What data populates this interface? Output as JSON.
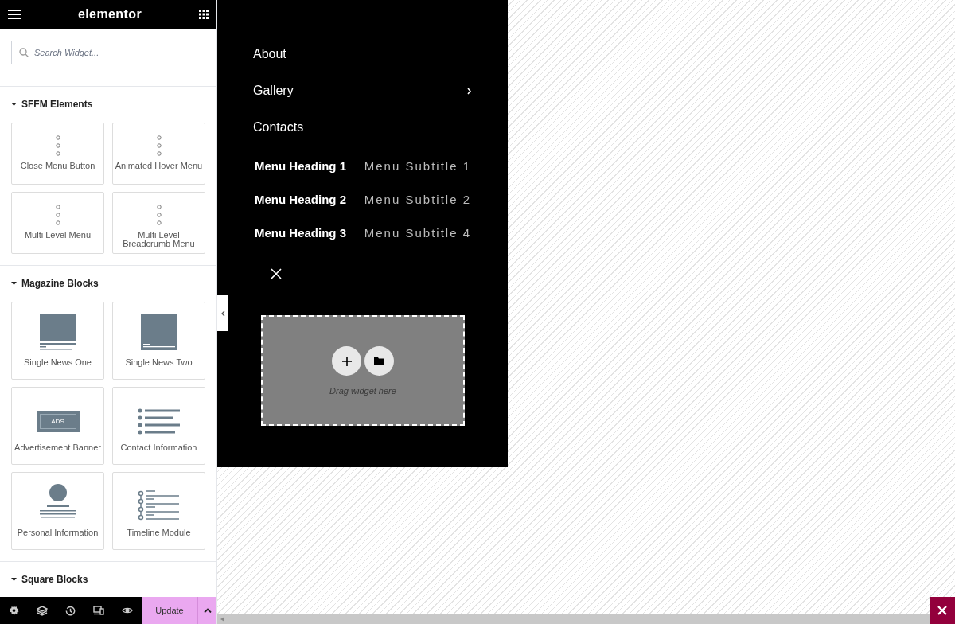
{
  "header": {
    "logo": "elementor"
  },
  "search": {
    "placeholder": "Search Widget..."
  },
  "categories": [
    {
      "title": "SFFM Elements",
      "expanded": true,
      "widgets": [
        {
          "label": "Close Menu Button",
          "kind": "dots"
        },
        {
          "label": "Animated Hover Menu",
          "kind": "dots"
        },
        {
          "label": "Multi Level Menu",
          "kind": "dots"
        },
        {
          "label": "Multi Level Breadcrumb Menu",
          "kind": "dots"
        }
      ]
    },
    {
      "title": "Magazine Blocks",
      "expanded": true,
      "widgets": [
        {
          "label": "Single News One",
          "kind": "news-one"
        },
        {
          "label": "Single News Two",
          "kind": "news-two"
        },
        {
          "label": "Advertisement Banner",
          "kind": "ads",
          "icon_text": "ADS"
        },
        {
          "label": "Contact Information",
          "kind": "list"
        },
        {
          "label": "Personal Information",
          "kind": "person"
        },
        {
          "label": "Timeline Module",
          "kind": "timeline"
        }
      ]
    },
    {
      "title": "Square Blocks",
      "expanded": true
    }
  ],
  "footer": {
    "update_button": "Update"
  },
  "menu": {
    "items": [
      {
        "label": "About",
        "has_submenu": false
      },
      {
        "label": "Gallery",
        "has_submenu": true
      },
      {
        "label": "Contacts",
        "has_submenu": false
      }
    ],
    "headings": [
      {
        "heading": "Menu Heading 1",
        "subtitle": "Menu Subtitle 1"
      },
      {
        "heading": "Menu Heading 2",
        "subtitle": "Menu Subtitle 2"
      },
      {
        "heading": "Menu Heading 3",
        "subtitle": "Menu Subtitle 4"
      }
    ]
  },
  "dropzone": {
    "hint": "Drag widget here"
  }
}
